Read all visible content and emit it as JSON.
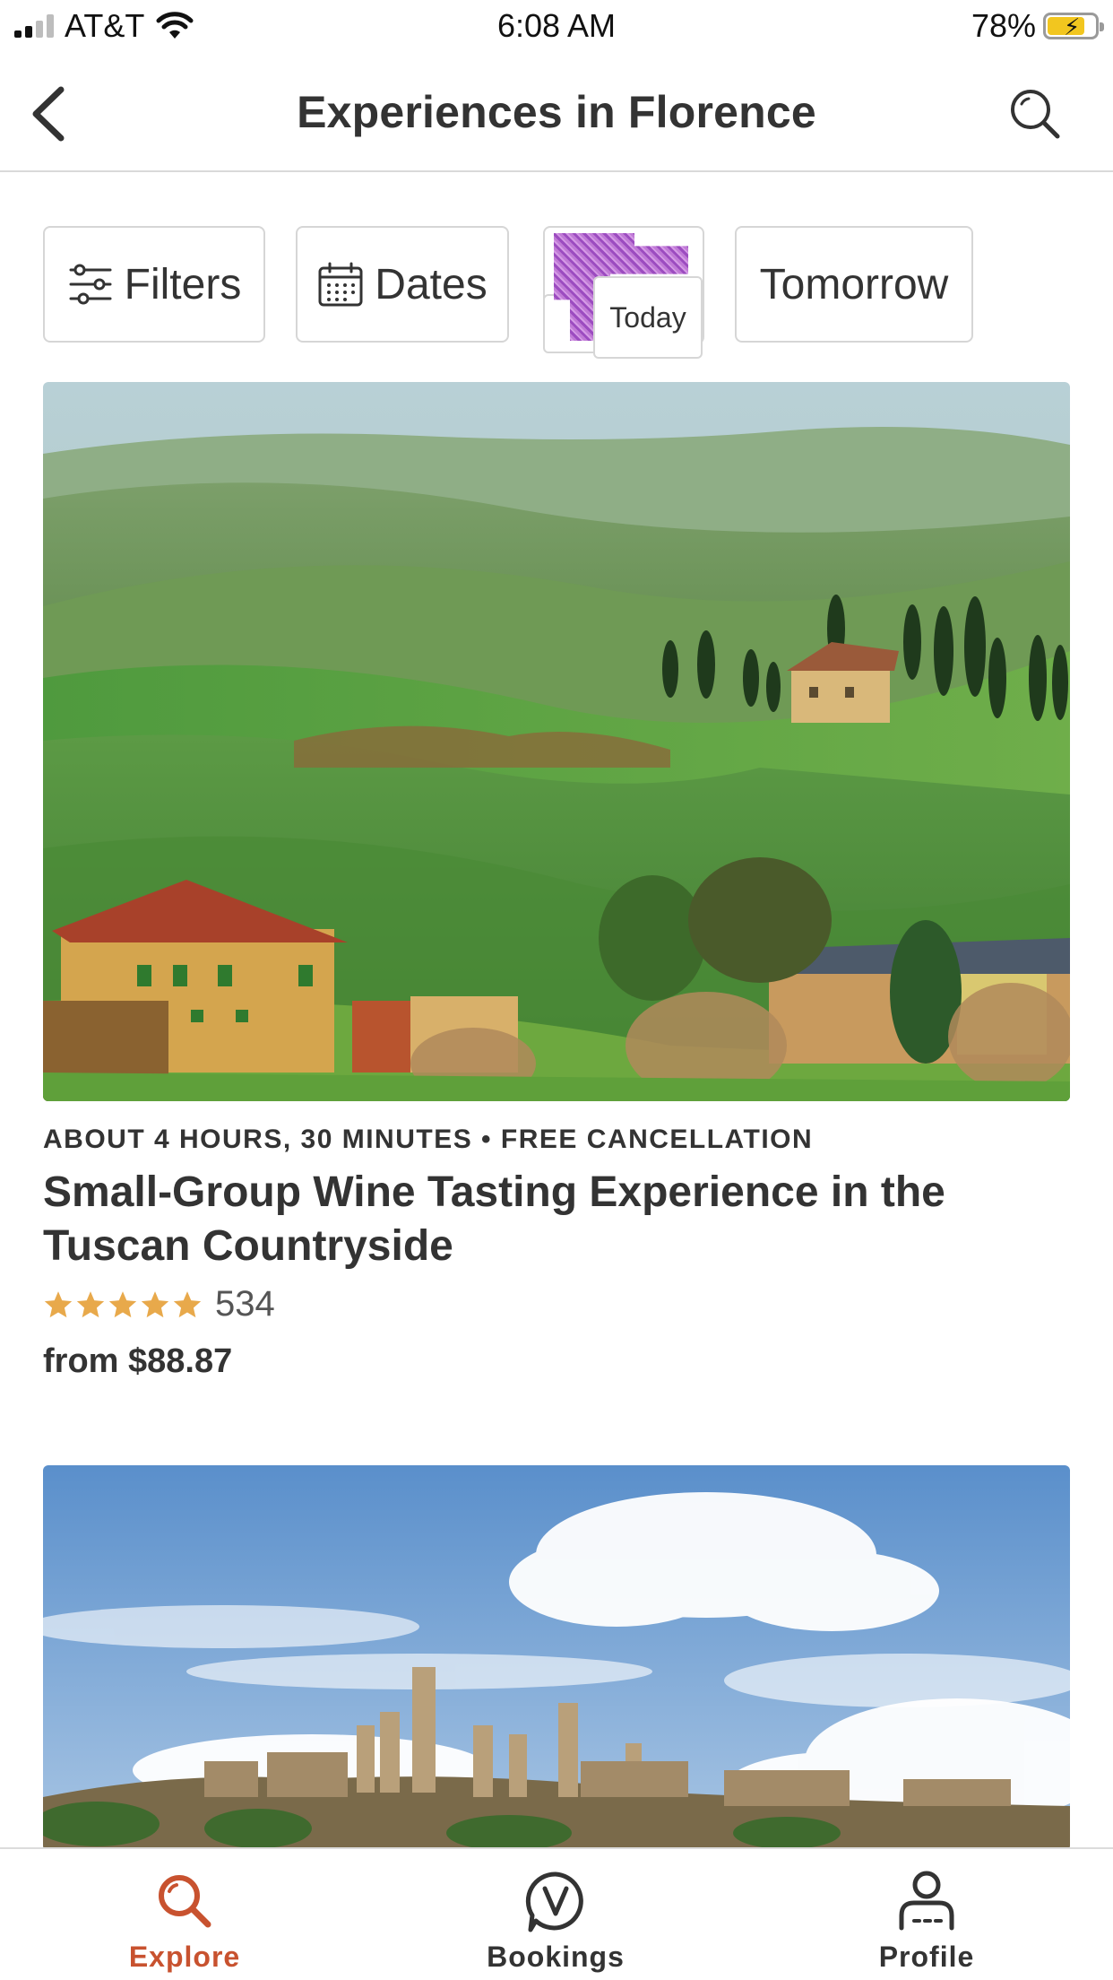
{
  "status_bar": {
    "carrier": "AT&T",
    "time": "6:08 AM",
    "battery": "78%",
    "battery_level": 0.78
  },
  "header": {
    "title": "Experiences in Florence",
    "back_icon": "chevron-left-icon",
    "search_icon": "search-icon"
  },
  "chips": {
    "filters": "Filters",
    "dates": "Dates",
    "today": "Today",
    "tomorrow": "Tomorrow"
  },
  "cards": [
    {
      "meta": "ABOUT 4 HOURS, 30 MINUTES • FREE CANCELLATION",
      "title": "Small-Group Wine Tasting Experience in the Tuscan Countryside",
      "rating": 5,
      "reviews": "534",
      "price": "from $88.87"
    },
    {}
  ],
  "tabs": [
    {
      "label": "Explore",
      "icon": "search-icon",
      "active": true
    },
    {
      "label": "Bookings",
      "icon": "bookings-icon",
      "active": false
    },
    {
      "label": "Profile",
      "icon": "profile-icon",
      "active": false
    }
  ],
  "colors": {
    "accent": "#c8522f",
    "star": "#e8a94b",
    "text": "#333333",
    "border": "#d6d6d6"
  }
}
